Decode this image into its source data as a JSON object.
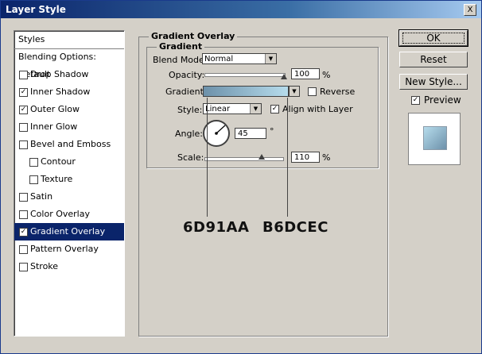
{
  "window": {
    "title": "Layer Style",
    "close_glyph": "X"
  },
  "styles_list": {
    "header": "Styles",
    "items": [
      {
        "label": "Blending Options: Default",
        "checkbox": false,
        "checked": false,
        "indent": false,
        "selected": false
      },
      {
        "label": "Drop Shadow",
        "checkbox": true,
        "checked": false,
        "indent": false,
        "selected": false
      },
      {
        "label": "Inner Shadow",
        "checkbox": true,
        "checked": true,
        "indent": false,
        "selected": false
      },
      {
        "label": "Outer Glow",
        "checkbox": true,
        "checked": true,
        "indent": false,
        "selected": false
      },
      {
        "label": "Inner Glow",
        "checkbox": true,
        "checked": false,
        "indent": false,
        "selected": false
      },
      {
        "label": "Bevel and Emboss",
        "checkbox": true,
        "checked": false,
        "indent": false,
        "selected": false
      },
      {
        "label": "Contour",
        "checkbox": true,
        "checked": false,
        "indent": true,
        "selected": false
      },
      {
        "label": "Texture",
        "checkbox": true,
        "checked": false,
        "indent": true,
        "selected": false
      },
      {
        "label": "Satin",
        "checkbox": true,
        "checked": false,
        "indent": false,
        "selected": false
      },
      {
        "label": "Color Overlay",
        "checkbox": true,
        "checked": false,
        "indent": false,
        "selected": false
      },
      {
        "label": "Gradient Overlay",
        "checkbox": true,
        "checked": true,
        "indent": false,
        "selected": true
      },
      {
        "label": "Pattern Overlay",
        "checkbox": true,
        "checked": false,
        "indent": false,
        "selected": false
      },
      {
        "label": "Stroke",
        "checkbox": true,
        "checked": false,
        "indent": false,
        "selected": false
      }
    ]
  },
  "gradient_overlay": {
    "section_title": "Gradient Overlay",
    "group_title": "Gradient",
    "blend_mode_label": "Blend Mode:",
    "blend_mode_value": "Normal",
    "opacity_label": "Opacity:",
    "opacity_value": "100",
    "opacity_unit": "%",
    "opacity_fraction": 1.0,
    "gradient_label": "Gradient:",
    "gradient_start_color": "#6D91AA",
    "gradient_end_color": "#B6DCEC",
    "reverse_label": "Reverse",
    "reverse_checked": false,
    "style_label": "Style:",
    "style_value": "Linear",
    "align_label": "Align with Layer",
    "align_checked": true,
    "angle_label": "Angle:",
    "angle_value": "45",
    "angle_unit": "°",
    "scale_label": "Scale:",
    "scale_value": "110",
    "scale_unit": "%",
    "scale_fraction": 0.73
  },
  "buttons": {
    "ok": "OK",
    "reset": "Reset",
    "new_style": "New Style...",
    "preview_label": "Preview",
    "preview_checked": true
  },
  "annotations": {
    "left_color": "6D91AA",
    "right_color": "B6DCEC"
  },
  "colors": {
    "selection": "#0a246a",
    "dialog_bg": "#d4d0c8"
  }
}
